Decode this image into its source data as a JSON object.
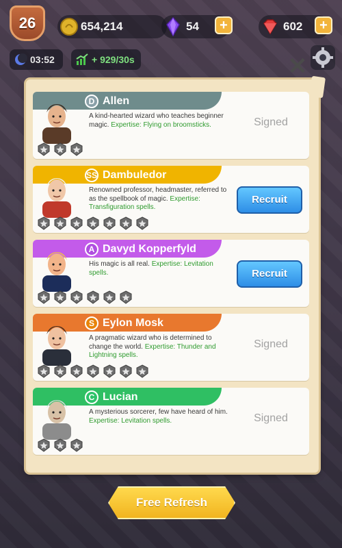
{
  "hud": {
    "level": "26",
    "coins": "654,214",
    "gems": "54",
    "rubies": "602",
    "timer": "03:52",
    "income_rate": "+ 929/30s",
    "colors": {
      "coin": "#e0b32a",
      "gem": "#8a4cf0",
      "ruby": "#e23b3b",
      "accent": "#f2b43b"
    }
  },
  "cards": [
    {
      "grade": "D",
      "grade_color": "#8aa0a8",
      "banner_color": "#6f8c8c",
      "name": "Allen",
      "description": "A kind-hearted wizard who teaches beginner magic.",
      "expertise": "Expertise: Flying on broomsticks.",
      "stars": 3,
      "status": "Signed",
      "action": null
    },
    {
      "grade": "SS",
      "grade_color": "#e8a900",
      "banner_color": "#f0b400",
      "name": "Dambuledor",
      "description": "Renowned professor, headmaster, referred to as the spellbook of magic.",
      "expertise": "Expertise: Transfiguration spells.",
      "stars": 7,
      "status": null,
      "action": "Recruit"
    },
    {
      "grade": "A",
      "grade_color": "#b04ee0",
      "banner_color": "#c35bea",
      "name": "Davyd Kopperfyld",
      "description": "His magic is all real.",
      "expertise": "Expertise: Levitation spells.",
      "stars": 6,
      "status": null,
      "action": "Recruit"
    },
    {
      "grade": "S",
      "grade_color": "#e8840a",
      "banner_color": "#e8782e",
      "name": "Eylon Mosk",
      "description": "A pragmatic wizard who is determined to change the world.",
      "expertise": "Expertise: Thunder and Lightning spells.",
      "stars": 7,
      "status": "Signed",
      "action": null
    },
    {
      "grade": "C",
      "grade_color": "#2ec36a",
      "banner_color": "#2fbf63",
      "name": "Lucian",
      "description": "A mysterious sorcerer, few have heard of him.",
      "expertise": "Expertise: Levitation spells.",
      "stars": 3,
      "status": "Signed",
      "action": null
    }
  ],
  "footer": {
    "refresh_label": "Free Refresh"
  }
}
